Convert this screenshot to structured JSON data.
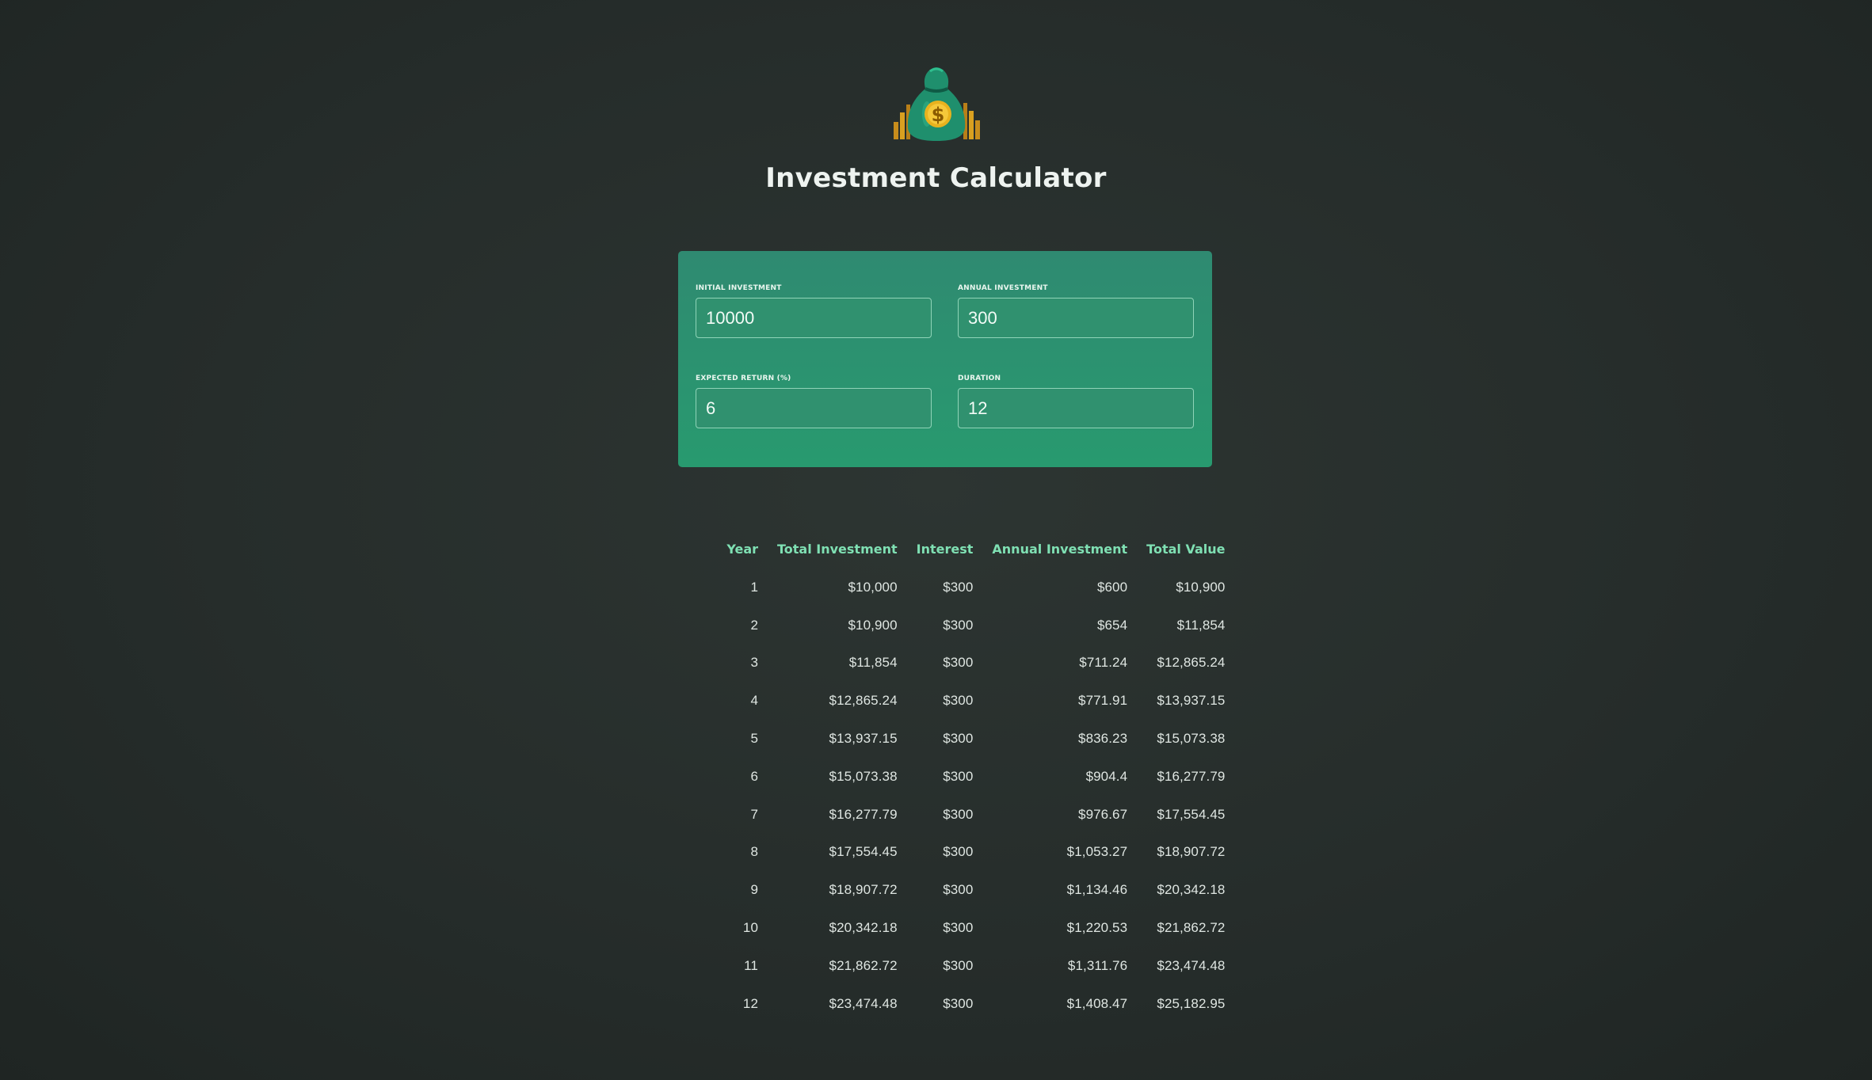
{
  "app": {
    "title": "Investment Calculator",
    "logo_icon": "money-bag-icon"
  },
  "inputs": {
    "initial_investment": {
      "label": "INITIAL INVESTMENT",
      "value": "10000"
    },
    "annual_investment": {
      "label": "ANNUAL INVESTMENT",
      "value": "300"
    },
    "expected_return": {
      "label": "EXPECTED RETURN (%)",
      "value": "6"
    },
    "duration": {
      "label": "DURATION",
      "value": "12"
    }
  },
  "table": {
    "headers": [
      "Year",
      "Total Investment",
      "Interest",
      "Annual Investment",
      "Total Value"
    ],
    "rows": [
      [
        "1",
        "$10,000",
        "$300",
        "$600",
        "$10,900"
      ],
      [
        "2",
        "$10,900",
        "$300",
        "$654",
        "$11,854"
      ],
      [
        "3",
        "$11,854",
        "$300",
        "$711.24",
        "$12,865.24"
      ],
      [
        "4",
        "$12,865.24",
        "$300",
        "$771.91",
        "$13,937.15"
      ],
      [
        "5",
        "$13,937.15",
        "$300",
        "$836.23",
        "$15,073.38"
      ],
      [
        "6",
        "$15,073.38",
        "$300",
        "$904.4",
        "$16,277.79"
      ],
      [
        "7",
        "$16,277.79",
        "$300",
        "$976.67",
        "$17,554.45"
      ],
      [
        "8",
        "$17,554.45",
        "$300",
        "$1,053.27",
        "$18,907.72"
      ],
      [
        "9",
        "$18,907.72",
        "$300",
        "$1,134.46",
        "$20,342.18"
      ],
      [
        "10",
        "$20,342.18",
        "$300",
        "$1,220.53",
        "$21,862.72"
      ],
      [
        "11",
        "$21,862.72",
        "$300",
        "$1,311.76",
        "$23,474.48"
      ],
      [
        "12",
        "$23,474.48",
        "$300",
        "$1,408.47",
        "$25,182.95"
      ]
    ]
  },
  "colors": {
    "background": "#262d2b",
    "panel": "#2b9470",
    "accent_header": "#7fe0b3",
    "text": "#dfe6e2"
  }
}
